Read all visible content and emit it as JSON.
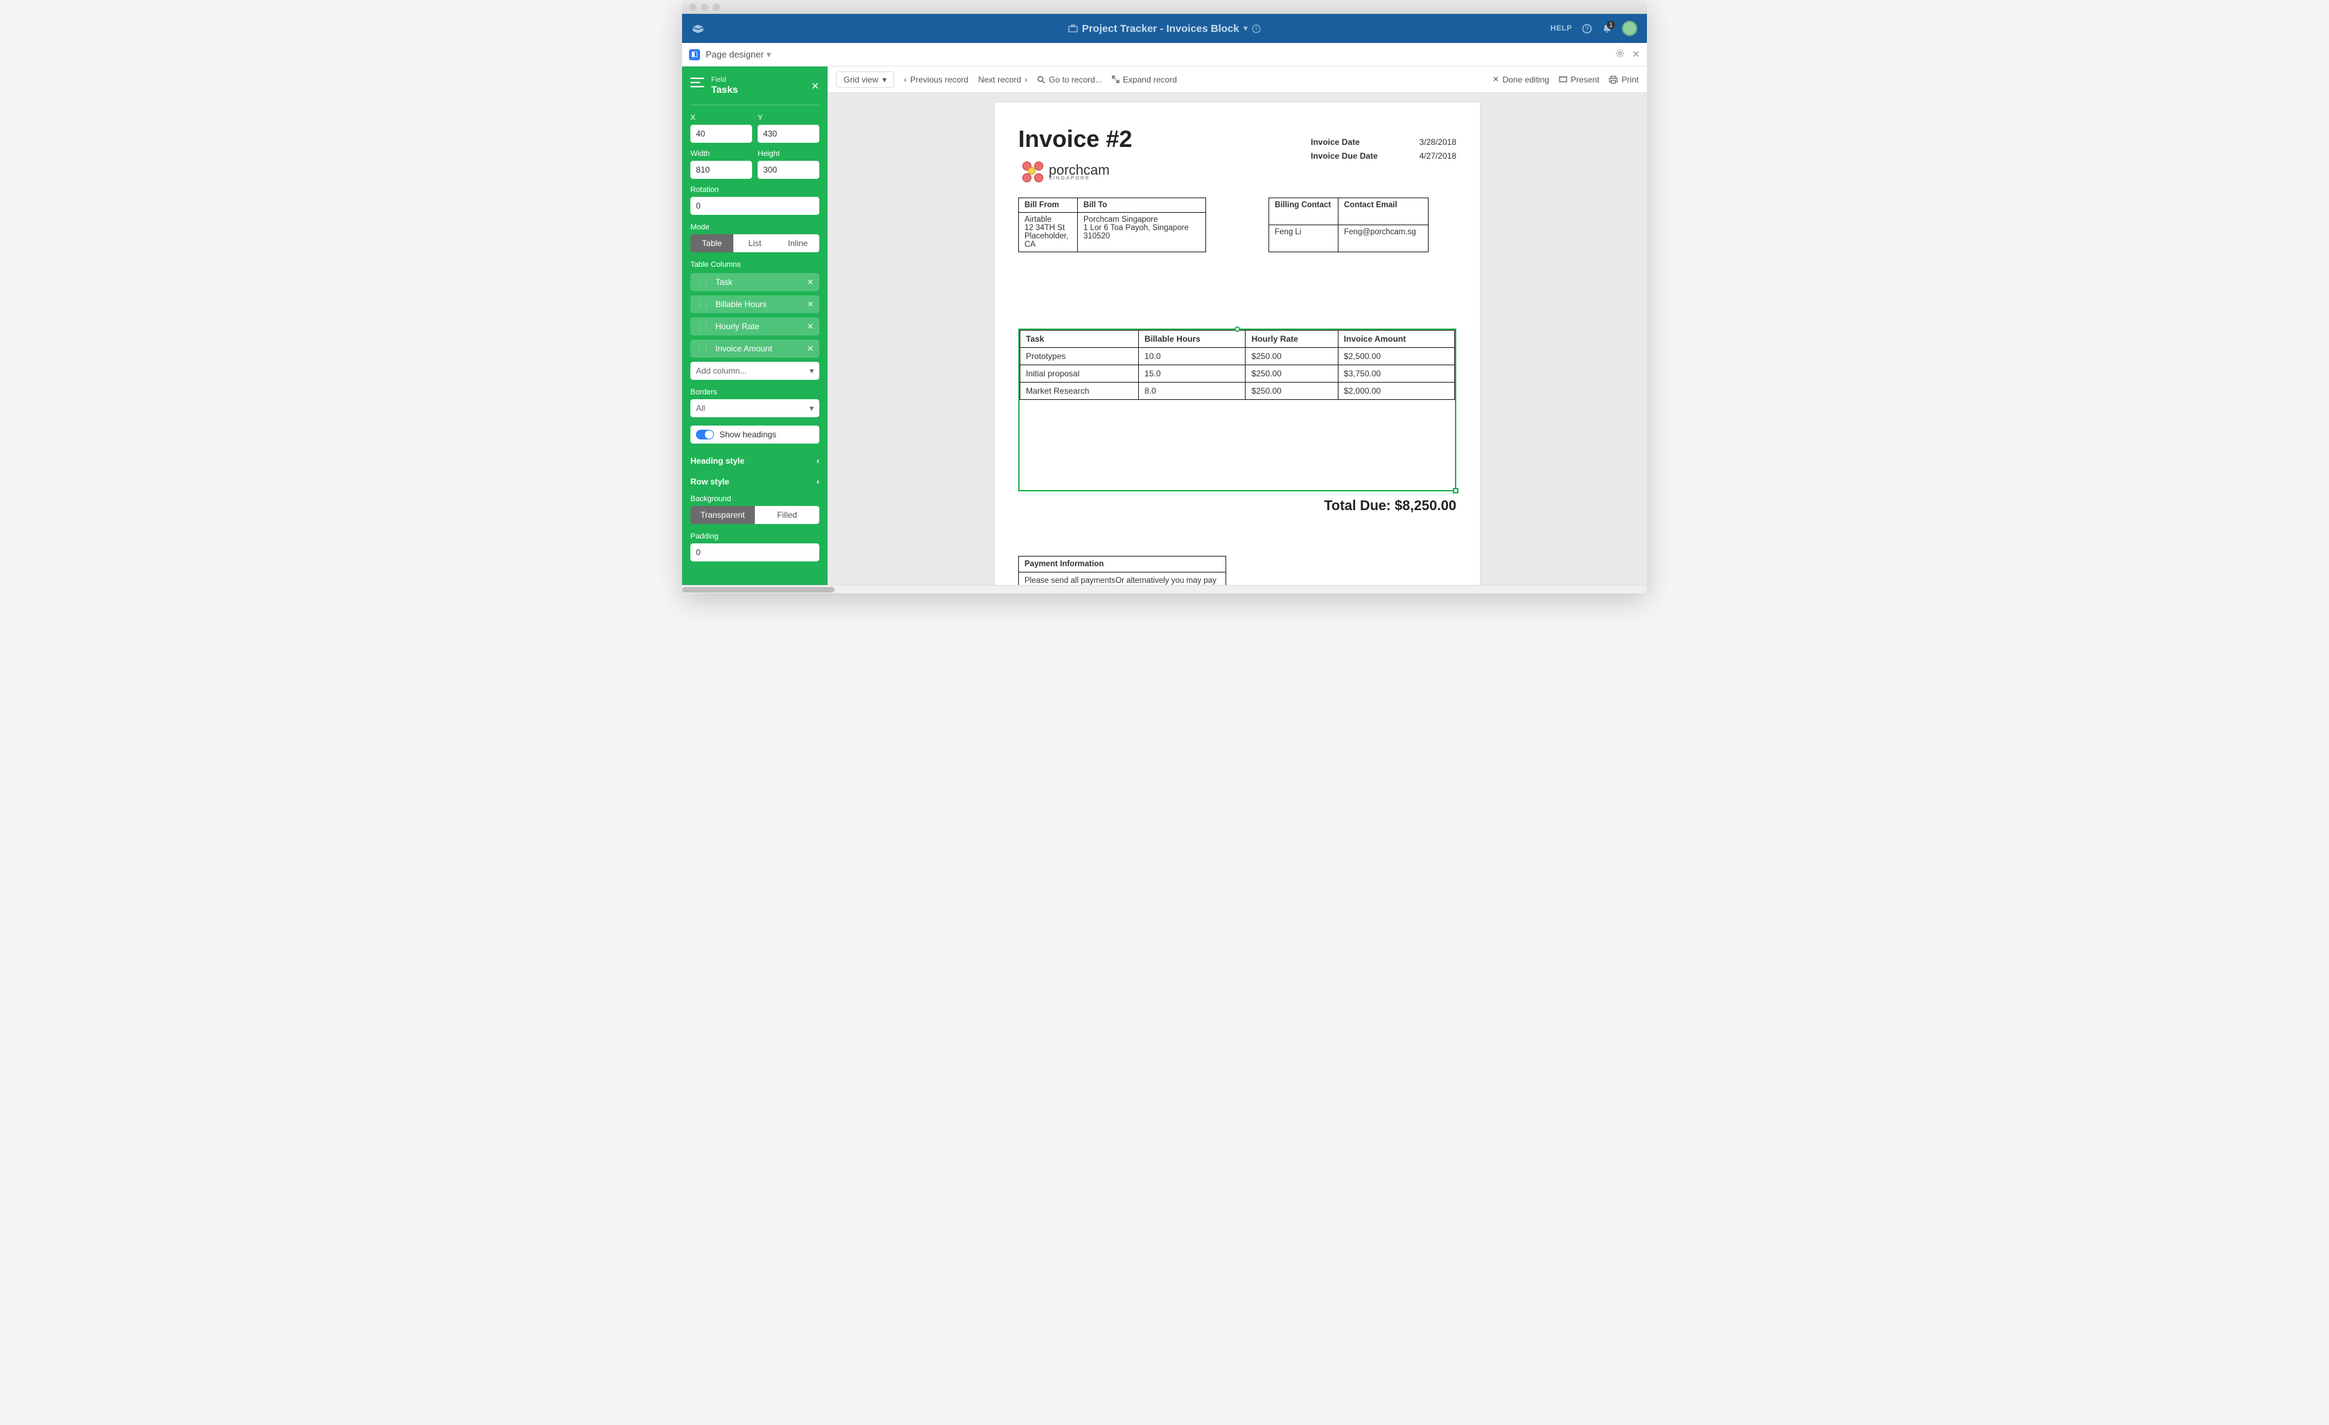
{
  "window": {
    "title": "Project Tracker - Invoices Block",
    "help": "HELP",
    "notifications": "1"
  },
  "blockbar": {
    "name": "Page designer"
  },
  "toolbar": {
    "view": "Grid view",
    "prev": "Previous record",
    "next": "Next record",
    "goto": "Go to record...",
    "expand": "Expand record",
    "done": "Done editing",
    "present": "Present",
    "print": "Print"
  },
  "sidebar": {
    "field_label": "Field",
    "field_name": "Tasks",
    "x_label": "X",
    "y_label": "Y",
    "x": "40",
    "y": "430",
    "width_label": "Width",
    "height_label": "Height",
    "width": "810",
    "height": "300",
    "rotation_label": "Rotation",
    "rotation": "0",
    "mode_label": "Mode",
    "mode_table": "Table",
    "mode_list": "List",
    "mode_inline": "Inline",
    "table_columns_label": "Table Columns",
    "columns": [
      "Task",
      "Billable Hours",
      "Hourly Rate",
      "Invoice Amount"
    ],
    "add_column": "Add column...",
    "borders_label": "Borders",
    "borders_value": "All",
    "show_headings": "Show headings",
    "heading_style": "Heading style",
    "row_style": "Row style",
    "background_label": "Background",
    "bg_transparent": "Transparent",
    "bg_filled": "Filled",
    "padding_label": "Padding",
    "padding": "0"
  },
  "invoice": {
    "title": "Invoice #2",
    "date_label": "Invoice Date",
    "date": "3/28/2018",
    "due_label": "Invoice Due Date",
    "due": "4/27/2018",
    "logo_name": "porchcam",
    "logo_sub": "SINGAPORE",
    "bill_from_hdr": "Bill From",
    "bill_to_hdr": "Bill To",
    "bill_from_l1": "Airtable",
    "bill_from_l2": "12 34TH St",
    "bill_from_l3": "Placeholder, CA",
    "bill_to_l1": "Porchcam Singapore",
    "bill_to_l2": "1 Lor 6 Toa Payoh, Singapore 310520",
    "contact_hdr": "Billing Contact",
    "email_hdr": "Contact Email",
    "contact": "Feng Li",
    "email": "Feng@porchcam.sg",
    "tasks_headers": [
      "Task",
      "Billable Hours",
      "Hourly Rate",
      "Invoice Amount"
    ],
    "tasks": [
      {
        "task": "Prototypes",
        "hours": "10.0",
        "rate": "$250.00",
        "amount": "$2,500.00"
      },
      {
        "task": "Initial proposal",
        "hours": "15.0",
        "rate": "$250.00",
        "amount": "$3,750.00"
      },
      {
        "task": "Market Research",
        "hours": "8.0",
        "rate": "$250.00",
        "amount": "$2,000.00"
      }
    ],
    "total_label": "Total Due:",
    "total": "$8,250.00",
    "payment_hdr": "Payment Information",
    "payment_l1": "Please send all payments via wire to XXXXXX XXXXXXXXX",
    "payment_l2": "Or alternatively you may pay with a card using XXXXXXXX processor"
  }
}
